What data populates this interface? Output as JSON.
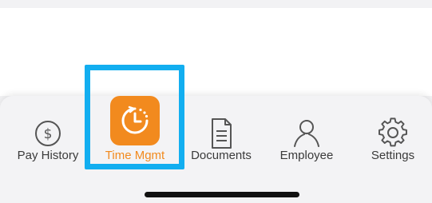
{
  "tab_bar": {
    "items": [
      {
        "label": "Pay History",
        "icon": "dollar-circle-icon",
        "active": false
      },
      {
        "label": "Time Mgmt",
        "icon": "clock-refresh-icon",
        "active": true
      },
      {
        "label": "Documents",
        "icon": "document-icon",
        "active": false
      },
      {
        "label": "Employee",
        "icon": "person-icon",
        "active": false
      },
      {
        "label": "Settings",
        "icon": "gear-icon",
        "active": false
      }
    ]
  },
  "colors": {
    "accent": "#f28a1e",
    "highlight": "#12aef0",
    "icon_gray": "#555555",
    "text": "#3a3a3a"
  }
}
